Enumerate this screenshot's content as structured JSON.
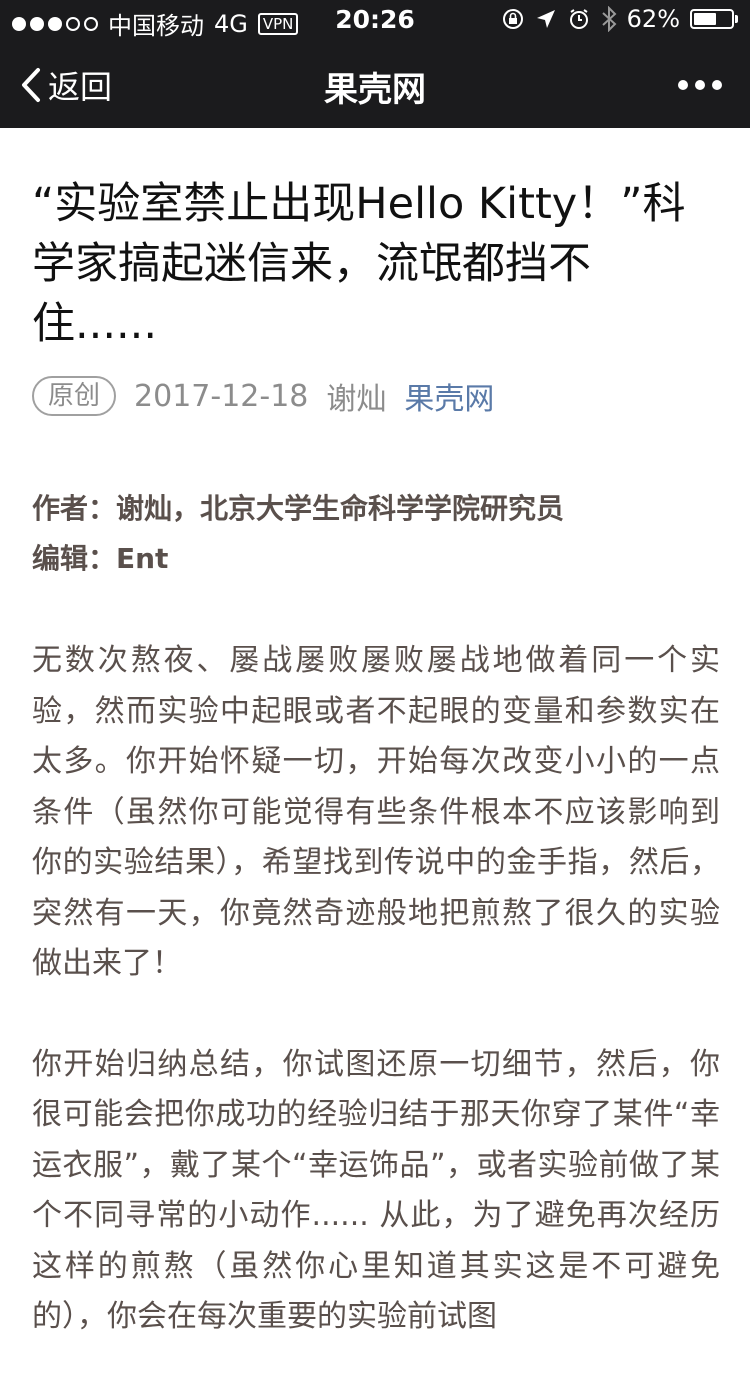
{
  "status_bar": {
    "carrier": "中国移动",
    "network": "4G",
    "vpn": "VPN",
    "time": "20:26",
    "battery_percent": "62%",
    "battery_level": 0.62
  },
  "nav": {
    "back_label": "返回",
    "title": "果壳网"
  },
  "article": {
    "title": "“实验室禁止出现Hello Kitty！”科学家搞起迷信来，流氓都挡不住......",
    "badge": "原创",
    "date": "2017-12-18",
    "author": "谢灿",
    "source": "果壳网",
    "credit_author": "作者：谢灿，北京大学生命科学学院研究员",
    "credit_editor": "编辑：Ent",
    "paragraphs": [
      "无数次熬夜、屡战屡败屡败屡战地做着同一个实验，然而实验中起眼或者不起眼的变量和参数实在太多。你开始怀疑一切，开始每次改变小小的一点条件（虽然你可能觉得有些条件根本不应该影响到你的实验结果），希望找到传说中的金手指，然后，突然有一天，你竟然奇迹般地把煎熬了很久的实验做出来了！",
      "你开始归纳总结，你试图还原一切细节，然后，你很可能会把你成功的经验归结于那天你穿了某件“幸运衣服”，戴了某个“幸运饰品”，或者实验前做了某个不同寻常的小动作...... 从此，为了避免再次经历这样的煎熬（虽然你心里知道其实这是不可避免的），你会在每次重要的实验前试图"
    ]
  }
}
